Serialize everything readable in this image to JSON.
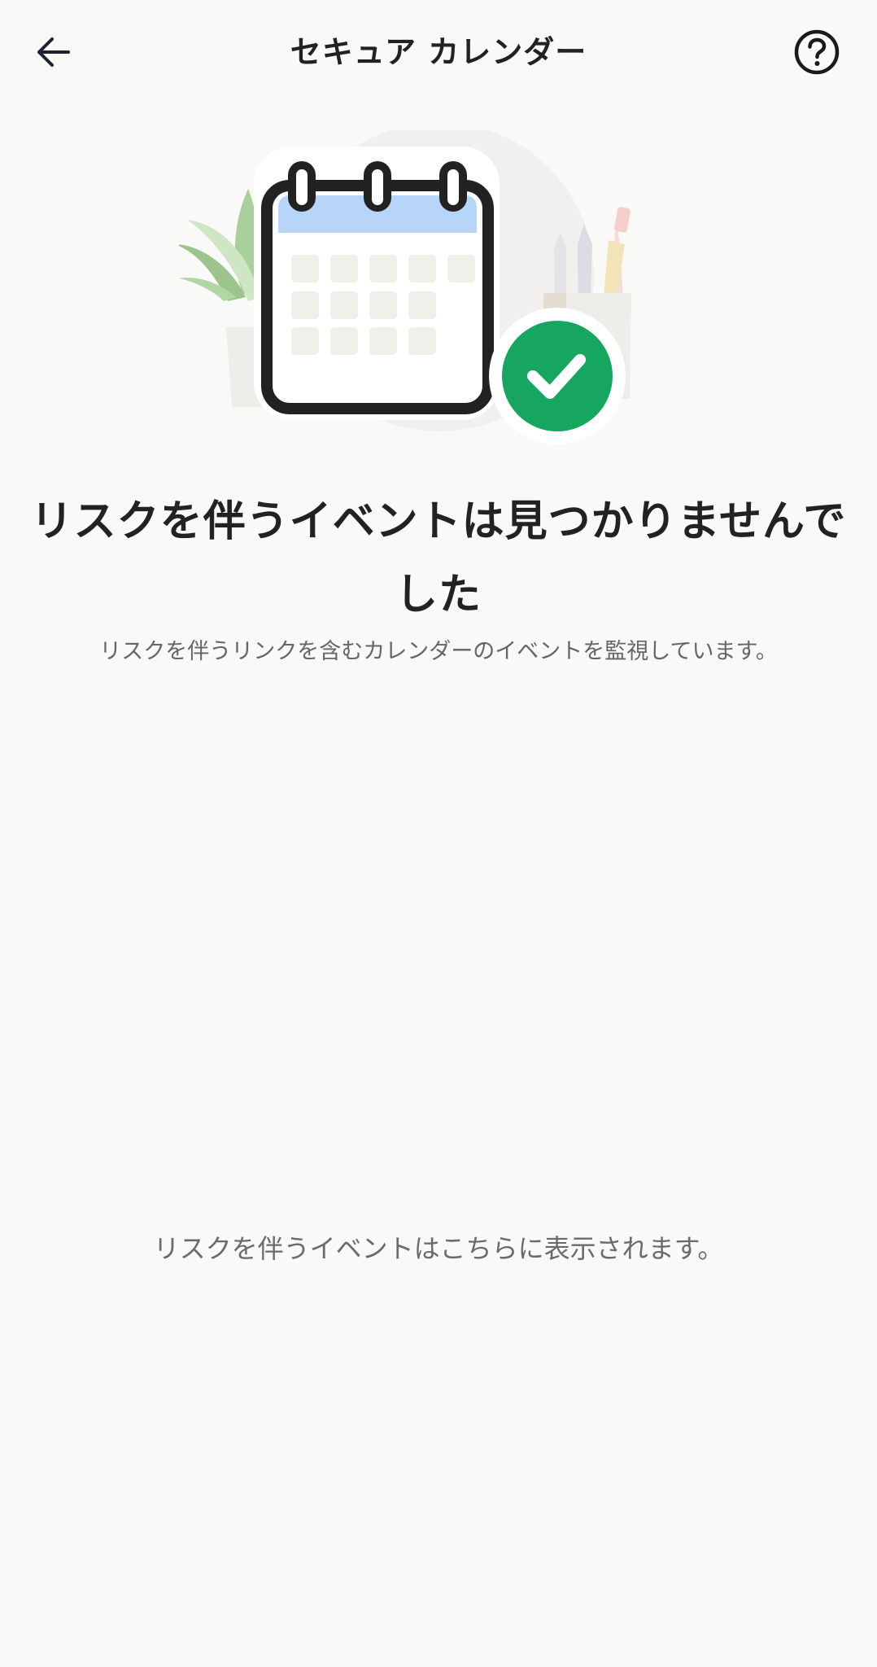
{
  "header": {
    "title": "セキュア カレンダー",
    "back_icon": "arrow-left-icon",
    "help_icon": "question-circle-icon"
  },
  "hero": {
    "illustration": "calendar-with-checkmark",
    "check_color": "#17a65f",
    "calendar_header_color": "#b7d5f8"
  },
  "main": {
    "headline": "リスクを伴うイベントは見つかりませんでした",
    "subtext": "リスクを伴うリンクを含むカレンダーのイベントを監視しています。",
    "empty_note": "リスクを伴うイベントはこちらに表示されます。"
  }
}
